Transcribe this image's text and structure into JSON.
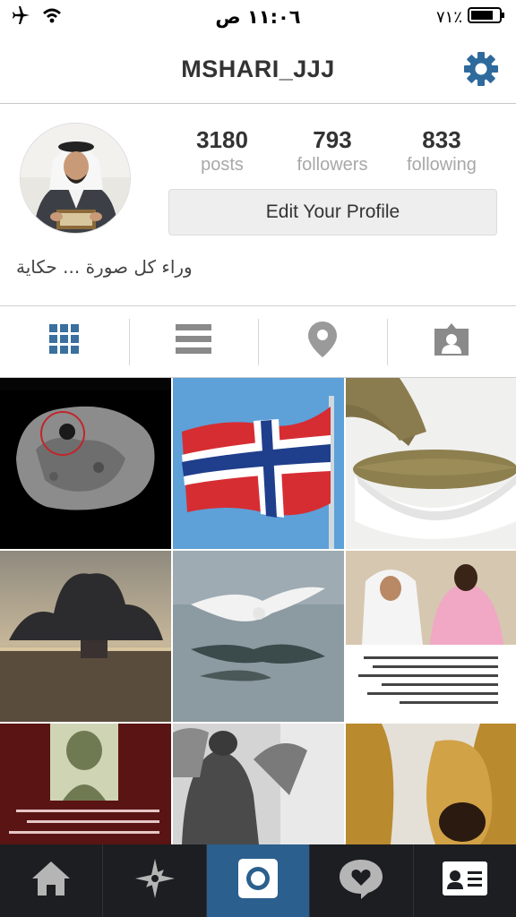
{
  "status_bar": {
    "time": "١١:٠٦ ص",
    "battery": "٧١٪"
  },
  "header": {
    "username": "MSHARI_JJJ"
  },
  "profile": {
    "stats": [
      {
        "value": "3180",
        "label": "posts"
      },
      {
        "value": "793",
        "label": "followers"
      },
      {
        "value": "833",
        "label": "following"
      }
    ],
    "edit_button_label": "Edit Your Profile",
    "bio": "وراء كل صورة ... حكاية"
  },
  "tabs": [
    "grid-icon",
    "list-icon",
    "location-icon",
    "tagged-icon"
  ],
  "grid_posts": [
    {
      "kind": "photo",
      "description": "dark asteroid rock with red circle"
    },
    {
      "kind": "photo",
      "description": "Norwegian flag on pole"
    },
    {
      "kind": "photo",
      "description": "bowl of green powder"
    },
    {
      "kind": "photo",
      "description": "storm cloud over sea"
    },
    {
      "kind": "photo",
      "description": "seagull flying over water"
    },
    {
      "kind": "photo",
      "description": "two men with arabic caption"
    },
    {
      "kind": "photo",
      "description": "portrait poster with arabic text"
    },
    {
      "kind": "photo",
      "description": "black and white soldiers"
    },
    {
      "kind": "photo",
      "description": "golden shoes"
    }
  ],
  "bottom_nav": [
    {
      "icon": "home-icon",
      "active": false
    },
    {
      "icon": "explore-icon",
      "active": false
    },
    {
      "icon": "camera-icon",
      "active": true
    },
    {
      "icon": "activity-icon",
      "active": false
    },
    {
      "icon": "profile-card-icon",
      "active": false
    }
  ],
  "colors": {
    "accent": "#2b5f8e",
    "grid_icon_active": "#3a6f9e",
    "tab_icon": "#8a8a8a",
    "nav_bg": "#1c1e22"
  }
}
